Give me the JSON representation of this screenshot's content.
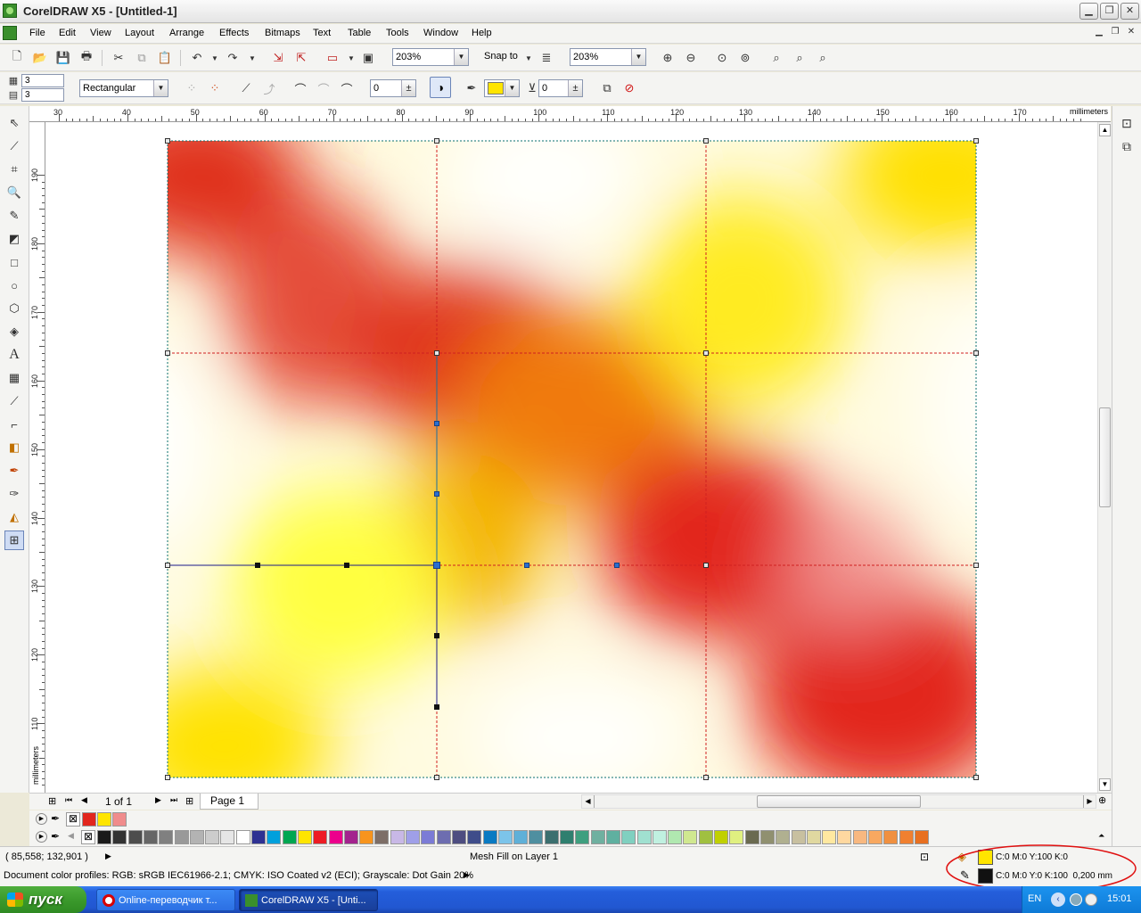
{
  "window": {
    "title": "CorelDRAW X5 - [Untitled-1]"
  },
  "menu": {
    "items": [
      "File",
      "Edit",
      "View",
      "Layout",
      "Arrange",
      "Effects",
      "Bitmaps",
      "Text",
      "Table",
      "Tools",
      "Window",
      "Help"
    ]
  },
  "toolbar": {
    "zoom_value": "203%",
    "snap_label": "Snap to",
    "zoom_value2": "203%",
    "grid_cols": "3",
    "grid_rows": "3",
    "selection_mode": "Rectangular",
    "smoothing_value": "0",
    "transparency_value": "0",
    "fill_color": "#ffe500"
  },
  "ruler": {
    "h_labels": [
      "30",
      "40",
      "50",
      "60",
      "70",
      "80",
      "90",
      "100",
      "110",
      "120",
      "130",
      "140",
      "150",
      "160",
      "170"
    ],
    "h_unit": "millimeters",
    "v_labels": [
      "190",
      "180",
      "170",
      "160",
      "150",
      "140",
      "130",
      "120",
      "110"
    ],
    "v_unit": "millimeters"
  },
  "pagebar": {
    "page_count": "1 of 1",
    "page_tab": "Page 1"
  },
  "palette": {
    "doc_colors": [
      "#e2261d",
      "#ffe500",
      "#f08c8c"
    ],
    "default_colors": [
      "#1a1a1a",
      "#333333",
      "#4d4d4d",
      "#666666",
      "#808080",
      "#999999",
      "#b3b3b3",
      "#cccccc",
      "#e6e6e6",
      "#ffffff",
      "#2e3192",
      "#00a0dc",
      "#00a651",
      "#ffe500",
      "#ed1c24",
      "#ec008c",
      "#a3238e",
      "#f7941d",
      "#7d6e67",
      "#c8b8e6",
      "#9f9fe8",
      "#7b7bd6",
      "#6d6db0",
      "#4d4d80",
      "#3f4d8a",
      "#0a7ac2",
      "#7cc4ea",
      "#5fb0d8",
      "#4f8fa0",
      "#3b6f6f",
      "#2f7f6f",
      "#3f9f7f",
      "#6fb0a0",
      "#5fb0a0",
      "#80d0c0",
      "#a0e0d0",
      "#c0f0e0",
      "#b0e8b0",
      "#d0e890",
      "#a0c040",
      "#c0d000",
      "#e0f080",
      "#6a6a50",
      "#909070",
      "#b0b090",
      "#c8c0a0",
      "#e0d8a0",
      "#ffe8a0",
      "#ffd8a0",
      "#f8b880",
      "#f8a860",
      "#f09040",
      "#f08030",
      "#e87020"
    ]
  },
  "status": {
    "coords": "( 85,558; 132,901 )",
    "object_info": "Mesh Fill on Layer 1",
    "color_profiles": "Document color profiles: RGB: sRGB IEC61966-2.1; CMYK: ISO Coated v2 (ECI); Grayscale: Dot Gain 20%",
    "fill_info": "C:0 M:0 Y:100 K:0",
    "fill_color": "#ffe500",
    "outline_info": "C:0 M:0 Y:0 K:100  0,200 mm",
    "outline_color": "#111111"
  },
  "taskbar": {
    "start": "пуск",
    "tasks": [
      "Online-переводчик т...",
      "CorelDRAW X5 - [Unti..."
    ],
    "lang": "EN",
    "time": "15:01"
  }
}
